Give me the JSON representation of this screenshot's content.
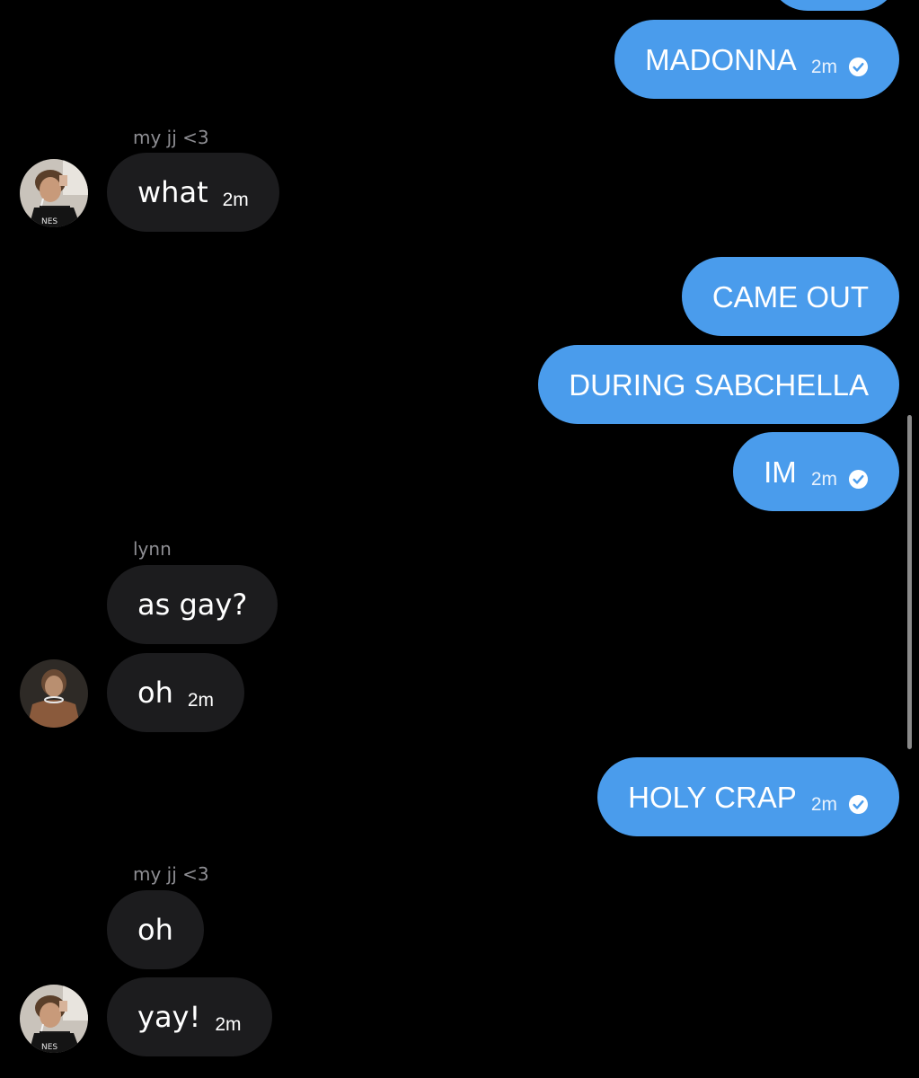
{
  "conversation": {
    "partial_top_bubble": "",
    "messages": [
      {
        "id": "m1",
        "direction": "out",
        "text": "MADONNA",
        "time": "2m",
        "read": true
      },
      {
        "id": "m2",
        "direction": "in",
        "sender": "my jj <3",
        "text": "what",
        "time": "2m"
      },
      {
        "id": "m3",
        "direction": "out",
        "text": "CAME OUT"
      },
      {
        "id": "m4",
        "direction": "out",
        "text": "DURING SABCHELLA"
      },
      {
        "id": "m5",
        "direction": "out",
        "text": "IM",
        "time": "2m",
        "read": true
      },
      {
        "id": "m6",
        "direction": "in",
        "sender": "lynn",
        "text": "as gay?"
      },
      {
        "id": "m7",
        "direction": "in",
        "text": "oh",
        "time": "2m"
      },
      {
        "id": "m8",
        "direction": "out",
        "text": "HOLY CRAP",
        "time": "2m",
        "read": true
      },
      {
        "id": "m9",
        "direction": "in",
        "sender": "my jj <3",
        "text": "oh"
      },
      {
        "id": "m10",
        "direction": "in",
        "text": "yay!",
        "time": "2m"
      }
    ]
  },
  "colors": {
    "background": "#000000",
    "outgoing_bubble": "#4a9cec",
    "incoming_bubble": "#1c1c1e",
    "sender_label": "#8e8e93"
  },
  "icons": {
    "read_receipt": "check-circle-icon",
    "avatar_jj": "avatar-jj",
    "avatar_lynn": "avatar-lynn"
  }
}
